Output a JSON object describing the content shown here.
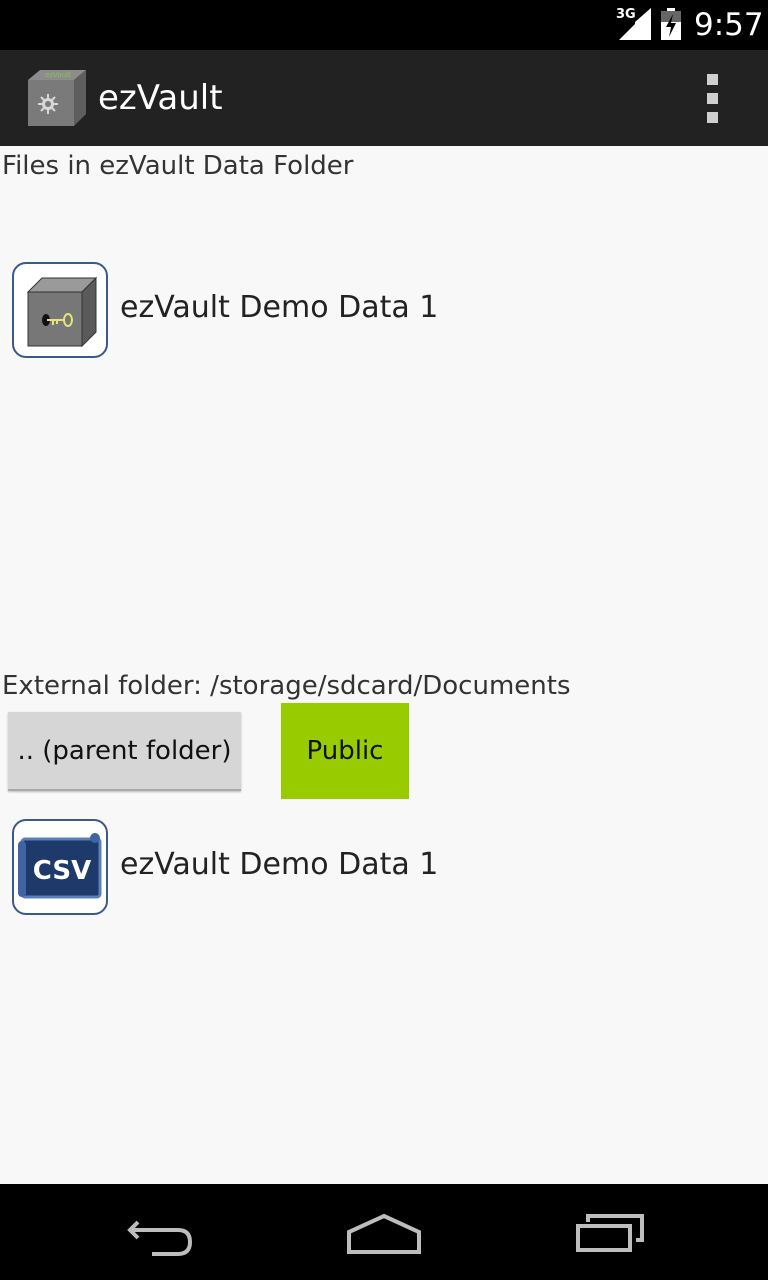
{
  "status_bar": {
    "network_label": "3G",
    "time": "9:57",
    "icons": [
      "signal-icon",
      "battery-icon"
    ]
  },
  "action_bar": {
    "title": "ezVault",
    "app_icon": "ezvault-safe-icon",
    "overflow_icon": "overflow-menu-icon"
  },
  "data_folder": {
    "label": "Files in ezVault Data Folder",
    "files": [
      {
        "name": "ezVault Demo Data 1",
        "icon": "vault-file-icon"
      }
    ]
  },
  "external_folder": {
    "label": "External folder: /storage/sdcard/Documents",
    "parent_button_label": ".. (parent folder)",
    "public_button_label": "Public",
    "public_button_color": "#99cc00",
    "files": [
      {
        "name": "ezVault Demo Data 1",
        "icon": "csv-file-icon",
        "badge": "CSV"
      }
    ]
  },
  "nav_bar": {
    "icons": [
      "back-icon",
      "home-icon",
      "recent-apps-icon"
    ]
  }
}
